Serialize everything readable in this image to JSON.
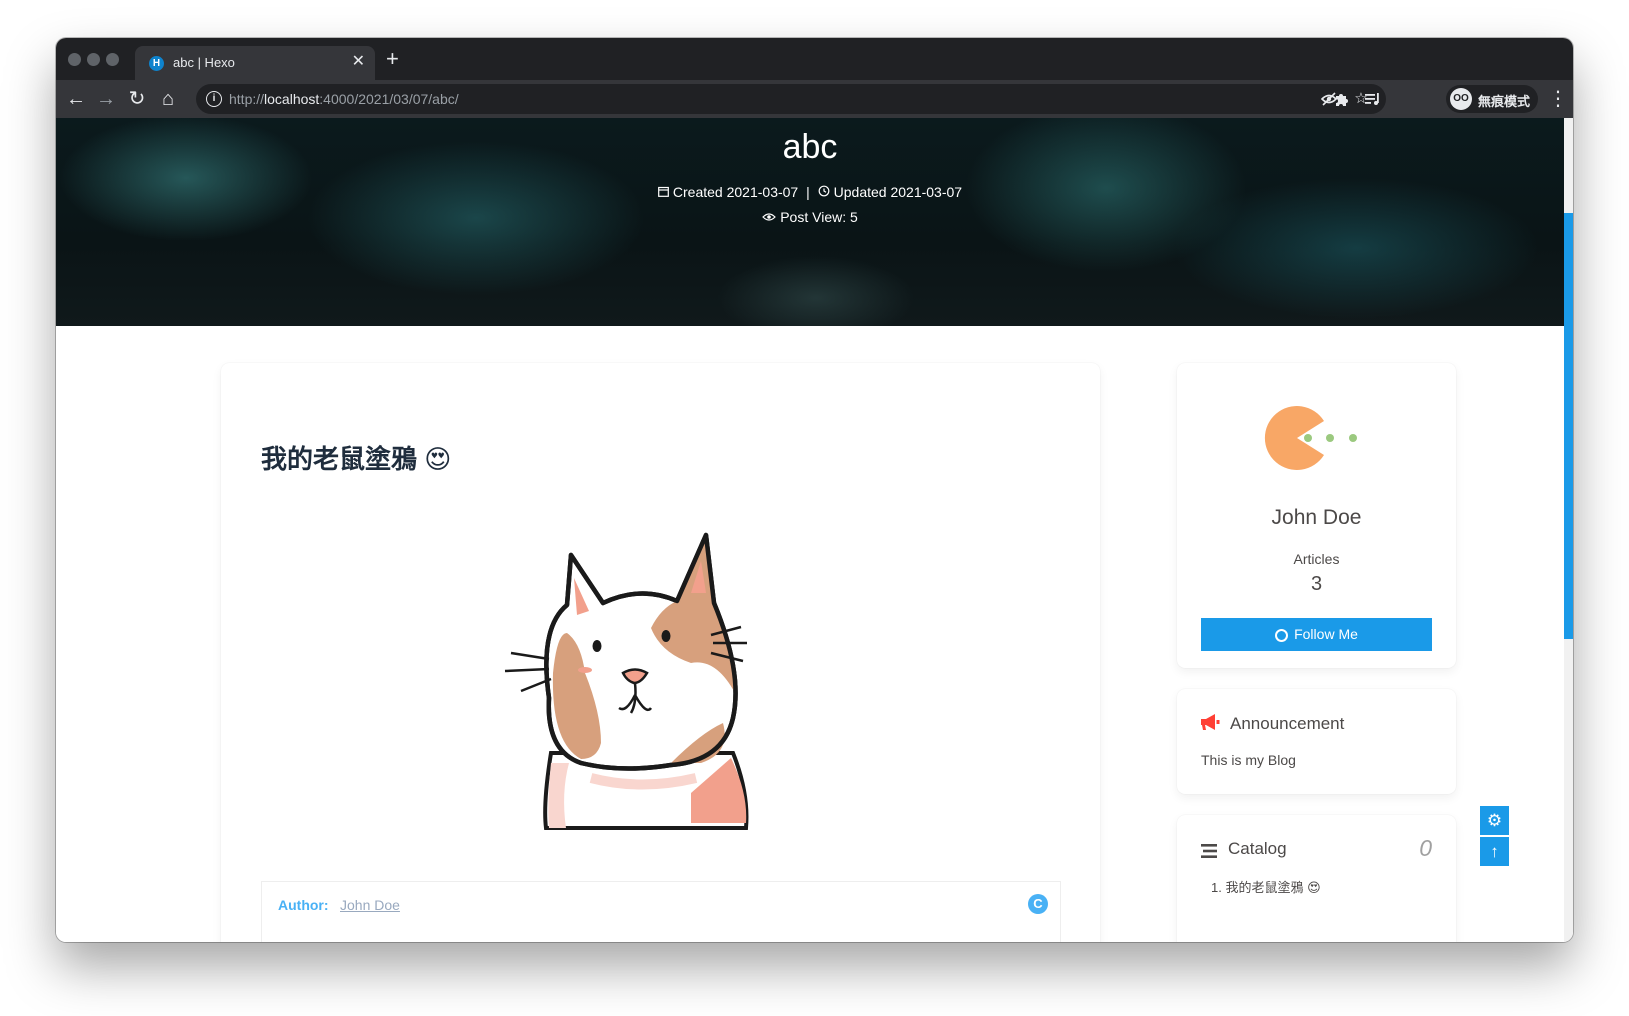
{
  "browser": {
    "tab_title": "abc | Hexo",
    "tab_favicon_letter": "H",
    "url_scheme": "http://",
    "url_host": "localhost",
    "url_path": ":4000/2021/03/07/abc/",
    "incognito_label": "無痕模式",
    "incognito_avatar": "OO"
  },
  "hero": {
    "title": "abc",
    "created_label": "Created 2021-03-07",
    "separator": "|",
    "updated_label": "Updated 2021-03-07",
    "views_label": "Post View: 5"
  },
  "post": {
    "heading": "我的老鼠塗鴉 😍",
    "copyright_author_label": "Author:",
    "copyright_author_name": "John Doe"
  },
  "sidebar": {
    "author_name": "John Doe",
    "articles_label": "Articles",
    "articles_count": "3",
    "follow_label": "Follow Me",
    "announcement_title": "Announcement",
    "announcement_body": "This is my Blog",
    "catalog_title": "Catalog",
    "catalog_percent": "0",
    "catalog_items": [
      "1. 我的老鼠塗鴉 😍"
    ]
  },
  "colors": {
    "accent": "#1a9ae8",
    "link": "#49b1f5",
    "announcement_icon": "#ff3f34",
    "avatar_orange": "#f8a766",
    "avatar_dot": "#9bc97f"
  },
  "icons": {
    "calendar": "calendar-icon",
    "history": "history-icon",
    "eye": "eye-icon",
    "github": "github-icon",
    "bullhorn": "bullhorn-icon",
    "stream": "stream-icon",
    "gear": "gear-icon",
    "arrow_up": "arrow-up-icon"
  }
}
